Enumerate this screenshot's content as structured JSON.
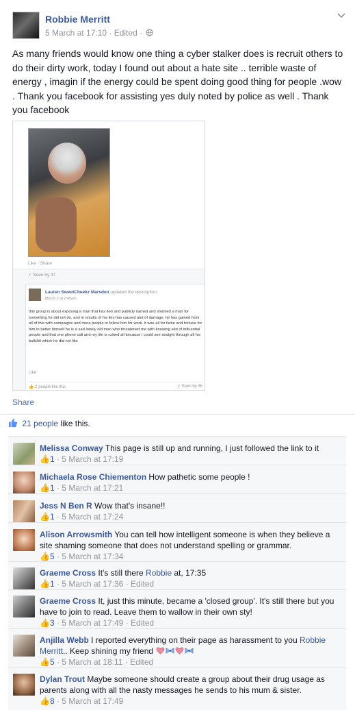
{
  "post": {
    "author": "Robbie Merritt",
    "meta": "5 March at 17:10 · Edited ·",
    "text": "As many friends would know one thing a cyber stalker does is recruit others to do their dirty work, today I found out about a hate site .. terrible waste of energy , imagin if the energy could be spent doing good thing for people .wow . Thank you facebook for assisting yes duly noted by police as well . Thank you facebook",
    "share_label": "Share",
    "likes_count": "21 people",
    "likes_suffix": " like this."
  },
  "embedded": {
    "like_share": "Like · Share",
    "seen_top": "Seen by 37",
    "card_author": "Lauren SweetCheekz Marsden",
    "card_action": " updated the description.",
    "card_date": "March 2 at 2:45pm",
    "card_text": "this group is about exposing a man that has lied and publicly named and shamed a man for something he did not do, and in results of his lies has caused alot of damage, he has gained from all of this with campaigns and more people to follow him for work. it was all for fame and fortune for him to better himself he is a sad lonely old man who threatened me with knowing alot of influential people and that one phone call and my life is ruined all because i could see straight through all his bullshit which he did not like",
    "card_like": "Like",
    "card_people_like": "2 people like this.",
    "card_seen": "Seen by 36"
  },
  "comments": [
    {
      "name": "Melissa Conway",
      "text": "This page is still up and running, I just followed the link to it",
      "likes": "1",
      "meta": " · 5 March at 17:19",
      "edited": ""
    },
    {
      "name": "Michaela Rose Chiementon",
      "text": "How pathetic some people !",
      "likes": "1",
      "meta": " · 5 March at 17:21",
      "edited": ""
    },
    {
      "name": "Jess N Ben R",
      "text": "Wow that's insane!!",
      "likes": "1",
      "meta": " · 5 March at 17:24",
      "edited": ""
    },
    {
      "name": "Alison Arrowsmith",
      "text": "You can tell how intelligent someone is when they believe a site shaming someone that does not understand spelling or grammar.",
      "likes": "5",
      "meta": " · 5 March at 17:34",
      "edited": ""
    },
    {
      "name": "Graeme Cross",
      "text": "It's still there ",
      "link": "Robbie",
      "text2": " at, 17:35",
      "likes": "1",
      "meta": " · 5 March at 17:36 · ",
      "edited": "Edited"
    },
    {
      "name": "Graeme Cross",
      "text": "It, just this minute, became a 'closed group'. It's still there but you have to join to read. Leave them to wallow in their own sty!",
      "likes": "3",
      "meta": " · 5 March at 17:49 · ",
      "edited": "Edited"
    },
    {
      "name": "Anjilla Webb",
      "text": "I reported everything on their page as harassment to you ",
      "link": "Robbie Merritt",
      "text2": ".. Keep shining my friend ",
      "likes": "5",
      "meta": " · 5 March at 18:11 · ",
      "edited": "Edited"
    },
    {
      "name": "Dylan Trout",
      "text": "Maybe someone should create a group about their drug usage as parents along with all the nasty messages he sends to his mum & sister.",
      "likes": "8",
      "meta": " · 5 March at 17:49",
      "edited": ""
    }
  ],
  "colors": {
    "link": "#3b5998",
    "meta": "#90949c",
    "like_blue": "#5890ff"
  },
  "icons": [
    "chevron-down-icon",
    "globe-icon",
    "thumbs-up-icon",
    "check-icon",
    "heart-emoji-icon",
    "bow-emoji-icon"
  ]
}
